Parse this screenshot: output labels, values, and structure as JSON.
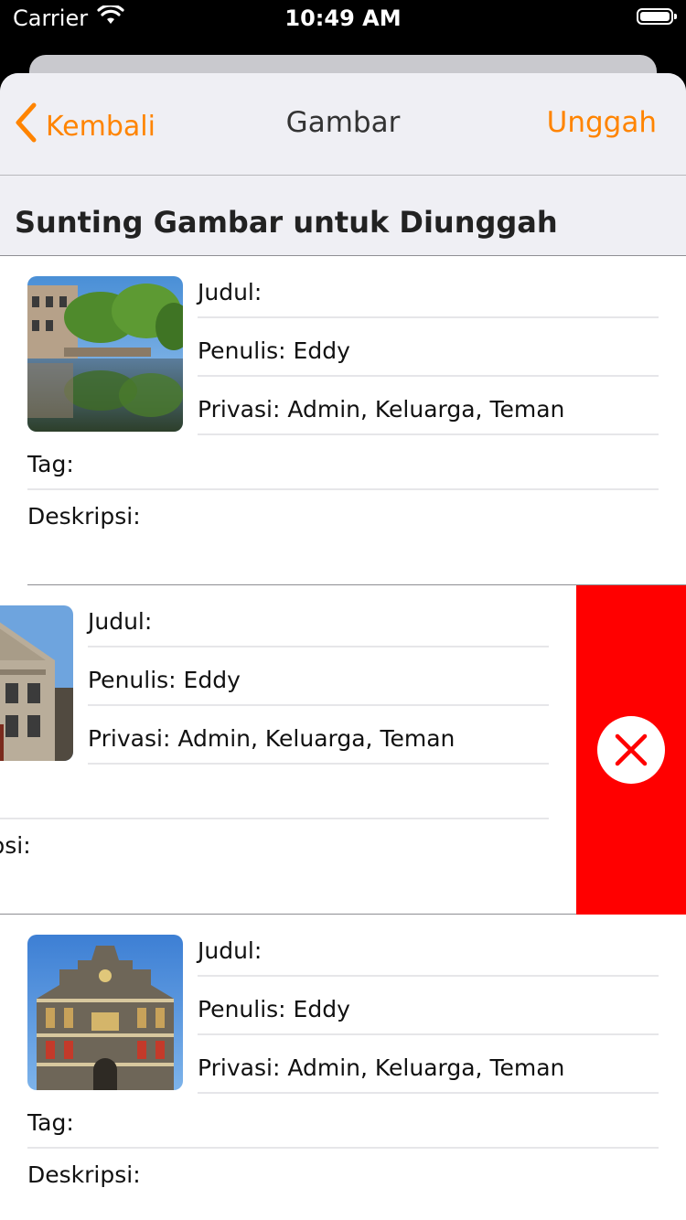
{
  "status_bar": {
    "carrier": "Carrier",
    "time": "10:49 AM"
  },
  "nav": {
    "back_label": "Kembali",
    "title": "Gambar",
    "upload_label": "Unggah"
  },
  "section": {
    "title": "Sunting Gambar untuk Diunggah"
  },
  "items": [
    {
      "title": "Judul:",
      "author": "Penulis: Eddy",
      "privacy": "Privasi: Admin, Keluarga, Teman",
      "tags": "Tag:",
      "description": "Deskripsi:"
    },
    {
      "title": "Judul:",
      "author": "Penulis: Eddy",
      "privacy": "Privasi: Admin, Keluarga, Teman",
      "tags": "",
      "description": "Deskripsi:"
    },
    {
      "title": "Judul:",
      "author": "Penulis: Eddy",
      "privacy": "Privasi: Admin, Keluarga, Teman",
      "tags": "Tag:",
      "description": "Deskripsi:"
    }
  ],
  "colors": {
    "accent": "#ff8400",
    "delete": "#ff0000"
  }
}
